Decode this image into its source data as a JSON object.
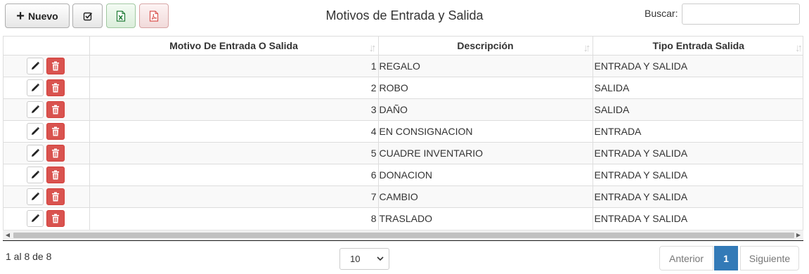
{
  "toolbar": {
    "new_label": "Nuevo",
    "check_icon": "check-square-icon",
    "excel_icon": "file-excel-icon",
    "pdf_icon": "file-pdf-icon"
  },
  "page": {
    "title": "Motivos de Entrada y Salida"
  },
  "search": {
    "label": "Buscar:",
    "value": "",
    "placeholder": ""
  },
  "table": {
    "columns": [
      "",
      "Motivo De Entrada O Salida",
      "Descripción",
      "Tipo Entrada Salida"
    ],
    "rows": [
      {
        "id": "1",
        "descripcion": "REGALO",
        "tipo": "ENTRADA Y SALIDA"
      },
      {
        "id": "2",
        "descripcion": "ROBO",
        "tipo": "SALIDA"
      },
      {
        "id": "3",
        "descripcion": "DAÑO",
        "tipo": "SALIDA"
      },
      {
        "id": "4",
        "descripcion": "EN CONSIGNACION",
        "tipo": "ENTRADA"
      },
      {
        "id": "5",
        "descripcion": "CUADRE INVENTARIO",
        "tipo": "ENTRADA Y SALIDA"
      },
      {
        "id": "6",
        "descripcion": "DONACION",
        "tipo": "ENTRADA Y SALIDA"
      },
      {
        "id": "7",
        "descripcion": "CAMBIO",
        "tipo": "ENTRADA Y SALIDA"
      },
      {
        "id": "8",
        "descripcion": "TRASLADO",
        "tipo": "ENTRADA Y SALIDA"
      }
    ]
  },
  "footer": {
    "info": "1 al 8 de 8",
    "page_size": "10",
    "prev_label": "Anterior",
    "current_page": "1",
    "next_label": "Siguiente"
  },
  "colors": {
    "accent": "#337ab7",
    "danger": "#d9534f",
    "excel": "#1e7b34",
    "pdf": "#d9534f"
  }
}
